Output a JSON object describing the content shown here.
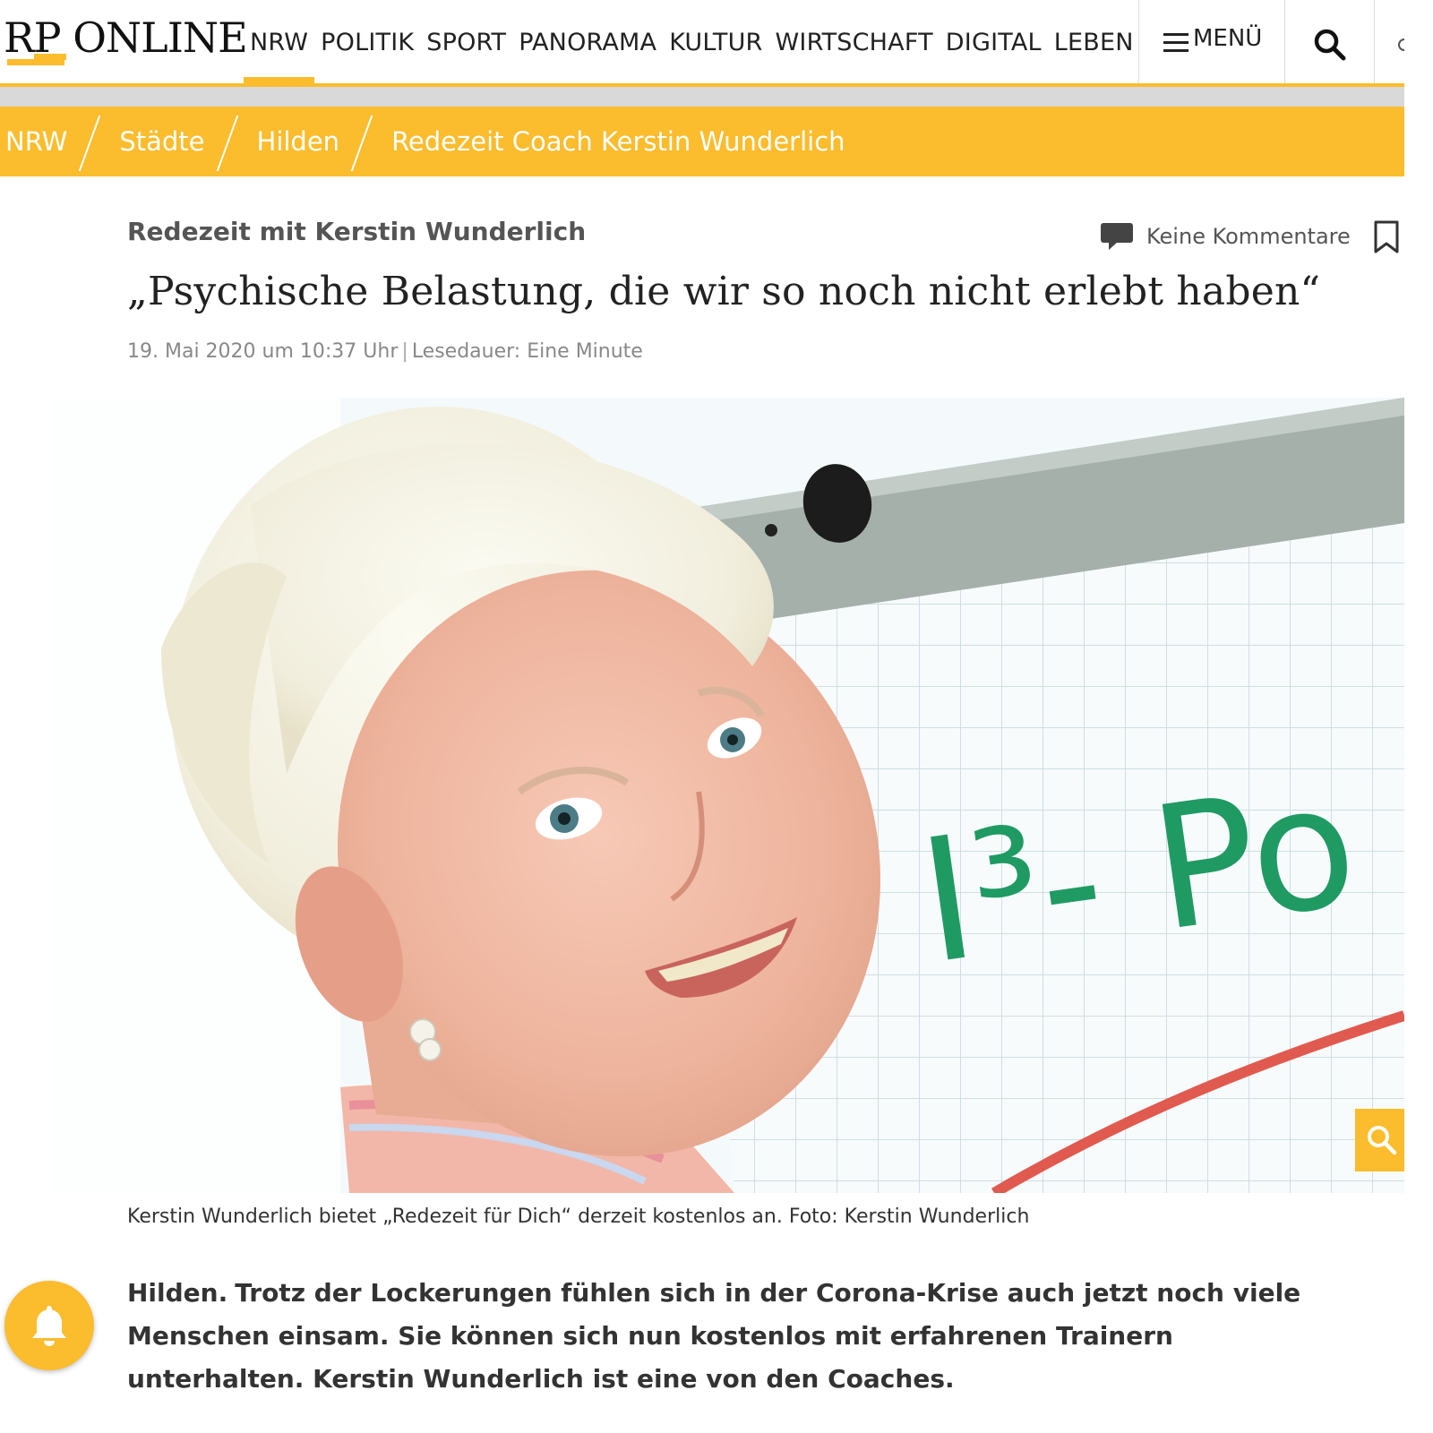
{
  "header": {
    "logo_text": "RP ONLINE",
    "nav": [
      "NRW",
      "POLITIK",
      "SPORT",
      "PANORAMA",
      "KULTUR",
      "WIRTSCHAFT",
      "DIGITAL",
      "LEBEN"
    ],
    "active_nav_index": 0,
    "menu_label": "MENÜ",
    "accent_color": "#fbbc2d"
  },
  "breadcrumb": {
    "items": [
      "NRW",
      "Städte",
      "Hilden",
      "Redezeit Coach Kerstin Wunderlich"
    ]
  },
  "article": {
    "kicker": "Redezeit mit Kerstin Wunderlich",
    "comments_label": "Keine Kommentare",
    "headline": "„Psychische Belastung, die wir so noch nicht erlebt haben“",
    "date": "19. Mai 2020 um 10:37 Uhr",
    "reading_time": "Lesedauer: Eine Minute",
    "photo_board_text": "I³- Po",
    "caption": "Kerstin Wunderlich bietet „Redezeit für Dich“ derzeit kostenlos an. Foto: Kerstin Wunderlich",
    "lead_location": "Hilden.",
    "lead_text": "Trotz der Lockerungen fühlen sich in der Corona-Krise auch jetzt noch viele Menschen einsam. Sie können sich nun kostenlos mit erfahrenen Trainern unterhalten. Kerstin Wunderlich ist eine von den Coaches."
  },
  "icons": {
    "search": "search-icon",
    "menu": "hamburger-icon",
    "comments": "comment-icon",
    "bookmark": "bookmark-icon",
    "notification": "bell-icon"
  }
}
